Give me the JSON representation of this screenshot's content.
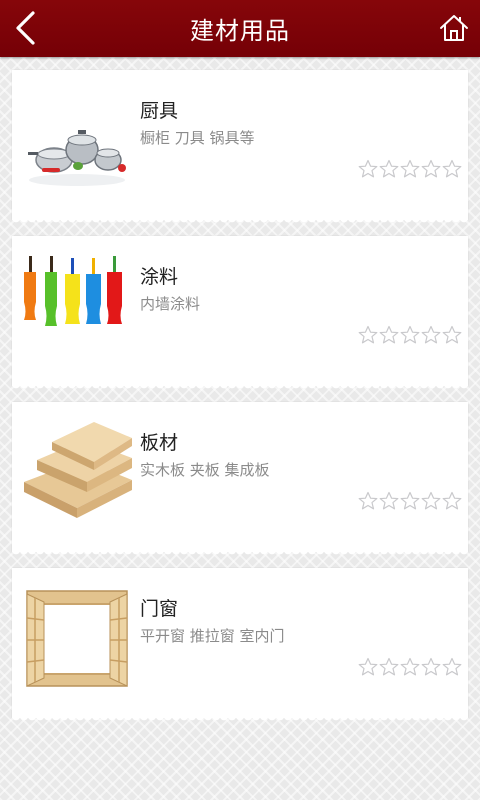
{
  "header": {
    "title": "建材用品",
    "back_icon": "back-arrow-icon",
    "home_icon": "home-icon",
    "background_color": "#7a0006"
  },
  "items": [
    {
      "title": "厨具",
      "subtitle": "橱柜 刀具 锅具等",
      "thumbnail": "cookware-thumbnail",
      "rating": 0,
      "rating_max": 5
    },
    {
      "title": "涂料",
      "subtitle": "内墙涂料",
      "thumbnail": "paint-rollers-thumbnail",
      "rating": 0,
      "rating_max": 5
    },
    {
      "title": "板材",
      "subtitle": "实木板 夹板 集成板",
      "thumbnail": "wood-boards-thumbnail",
      "rating": 0,
      "rating_max": 5
    },
    {
      "title": "门窗",
      "subtitle": "平开窗 推拉窗 室内门",
      "thumbnail": "window-frame-thumbnail",
      "rating": 0,
      "rating_max": 5
    }
  ]
}
